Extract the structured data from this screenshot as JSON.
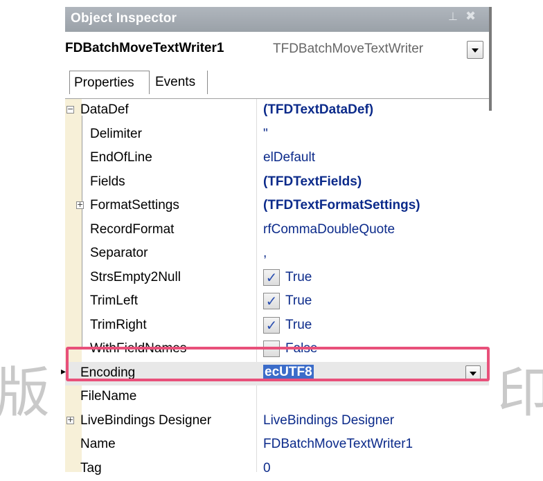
{
  "inspector": {
    "title": "Object Inspector",
    "pin_glyph": "⊥",
    "close_glyph": "✖",
    "component_name": "FDBatchMoveTextWriter1",
    "component_type": "TFDBatchMoveTextWriter"
  },
  "tabs": [
    {
      "label": "Properties",
      "active": true
    },
    {
      "label": "Events",
      "active": false
    }
  ],
  "properties": [
    {
      "name": "DataDef",
      "value": "(TFDTextDataDef)",
      "bold": true,
      "expander": "minus"
    },
    {
      "name": "Delimiter",
      "value": "\""
    },
    {
      "name": "EndOfLine",
      "value": "elDefault"
    },
    {
      "name": "Fields",
      "value": "(TFDTextFields)",
      "bold": true
    },
    {
      "name": "FormatSettings",
      "value": "(TFDTextFormatSettings)",
      "bold": true,
      "expander": "plus"
    },
    {
      "name": "RecordFormat",
      "value": "rfCommaDoubleQuote"
    },
    {
      "name": "Separator",
      "value": ","
    },
    {
      "name": "StrsEmpty2Null",
      "value": "True",
      "checked": true
    },
    {
      "name": "TrimLeft",
      "value": "True",
      "checked": true
    },
    {
      "name": "TrimRight",
      "value": "True",
      "checked": true
    },
    {
      "name": "WithFieldNames",
      "value": "False",
      "checked": false
    },
    {
      "name": "Encoding",
      "value": "ecUTF8",
      "selected": true
    },
    {
      "name": "FileName",
      "value": ""
    },
    {
      "name": "LiveBindings Designer",
      "value": "LiveBindings Designer",
      "expander": "plus"
    },
    {
      "name": "Name",
      "value": "FDBatchMoveTextWriter1"
    },
    {
      "name": "Tag",
      "value": "0"
    }
  ],
  "watermark": {
    "left": "版",
    "right": "印"
  },
  "colors": {
    "highlight": "#e8507a",
    "selection": "#3b6cc9",
    "value_text": "#0b2a8a"
  }
}
